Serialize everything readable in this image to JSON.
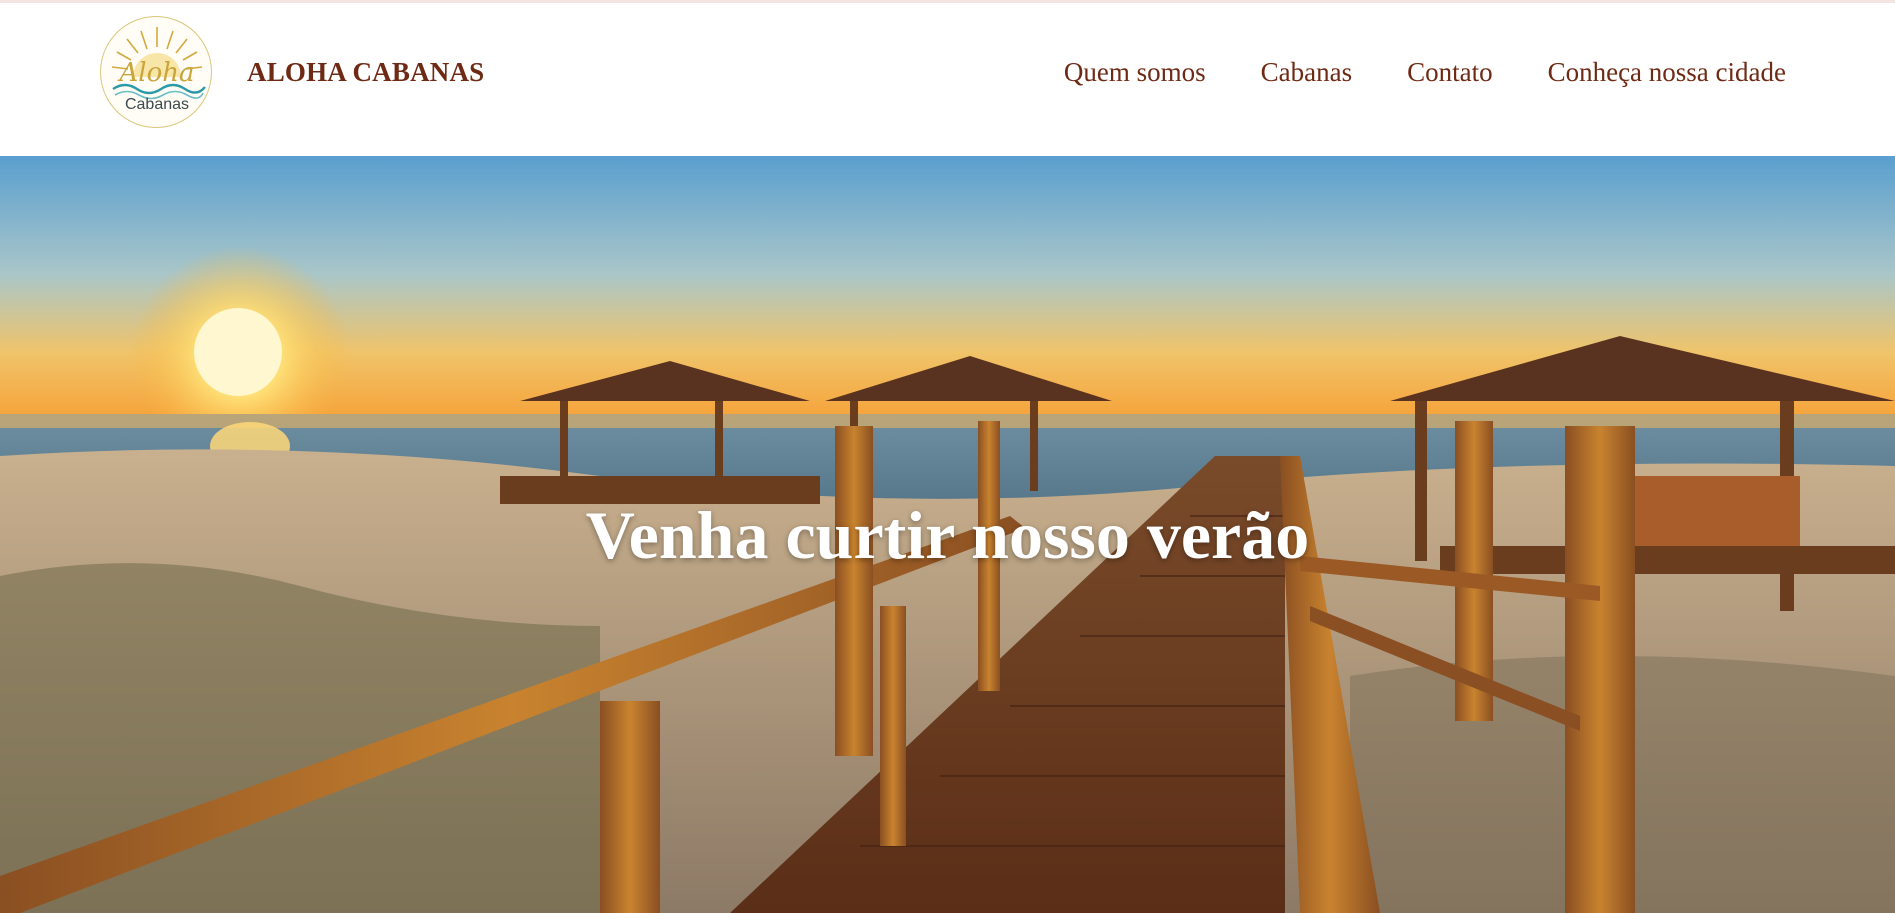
{
  "header": {
    "logo": {
      "text_top": "Aloha",
      "text_bottom": "Cabanas",
      "icon": "sun-wave-logo-icon"
    },
    "brand_name": "ALOHA CABANAS",
    "nav": [
      {
        "label": "Quem somos"
      },
      {
        "label": "Cabanas"
      },
      {
        "label": "Contato"
      },
      {
        "label": "Conheça nossa cidade"
      }
    ]
  },
  "hero": {
    "title": "Venha curtir nosso verão",
    "image": "sunset-beach-boardwalk-image"
  },
  "colors": {
    "brand": "#6e2a14",
    "logo_gold": "#c8a43a",
    "logo_teal": "#2b9aa8",
    "hero_text": "#ffffff"
  }
}
